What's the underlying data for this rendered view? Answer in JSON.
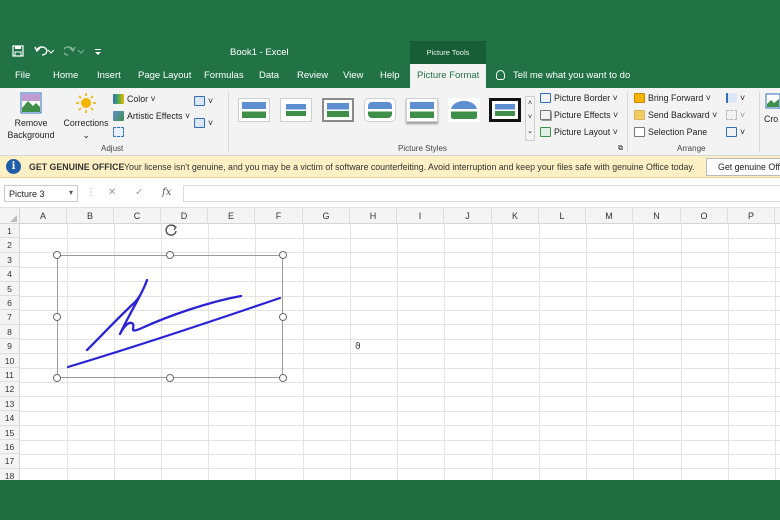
{
  "window": {
    "doc_title": "Book1  -  Excel",
    "context_group": "Picture Tools"
  },
  "tabs": [
    {
      "label": "File"
    },
    {
      "label": "Home"
    },
    {
      "label": "Insert"
    },
    {
      "label": "Page Layout"
    },
    {
      "label": "Formulas"
    },
    {
      "label": "Data"
    },
    {
      "label": "Review"
    },
    {
      "label": "View"
    },
    {
      "label": "Help"
    },
    {
      "label": "Picture Format",
      "active": true
    }
  ],
  "tell_me": "Tell me what you want to do",
  "ribbon": {
    "adjust": {
      "remove_background_1": "Remove",
      "remove_background_2": "Background",
      "corrections": "Corrections",
      "color": "Color",
      "artistic_effects": "Artistic Effects",
      "group_label": "Adjust"
    },
    "picture_styles": {
      "group_label": "Picture Styles",
      "picture_border": "Picture Border",
      "picture_effects": "Picture Effects",
      "picture_layout": "Picture Layout"
    },
    "arrange": {
      "bring_forward": "Bring Forward",
      "send_backward": "Send Backward",
      "selection_pane": "Selection Pane",
      "group_label": "Arrange"
    },
    "size": {
      "crop": "Cro"
    }
  },
  "message_bar": {
    "title": "GET GENUINE OFFICE",
    "text": "Your license isn't genuine, and you may be a victim of software counterfeiting. Avoid interruption and keep your files safe with genuine Office today.",
    "button": "Get genuine Office"
  },
  "formula_bar": {
    "name_box": "Picture 3",
    "fx": "fx"
  },
  "sheet": {
    "columns": [
      "A",
      "B",
      "C",
      "D",
      "E",
      "F",
      "G",
      "H",
      "I",
      "J",
      "K",
      "L",
      "M",
      "N",
      "O",
      "P"
    ],
    "rows": [
      "1",
      "2",
      "3",
      "4",
      "5",
      "6",
      "7",
      "8",
      "9",
      "10",
      "11",
      "12",
      "13",
      "14",
      "15",
      "16",
      "17",
      "18"
    ],
    "cell_mark": "ϑ"
  },
  "colors": {
    "excel_green": "#217346",
    "signature_blue": "#2a23d6",
    "message_bar": "#fdf0c4"
  }
}
